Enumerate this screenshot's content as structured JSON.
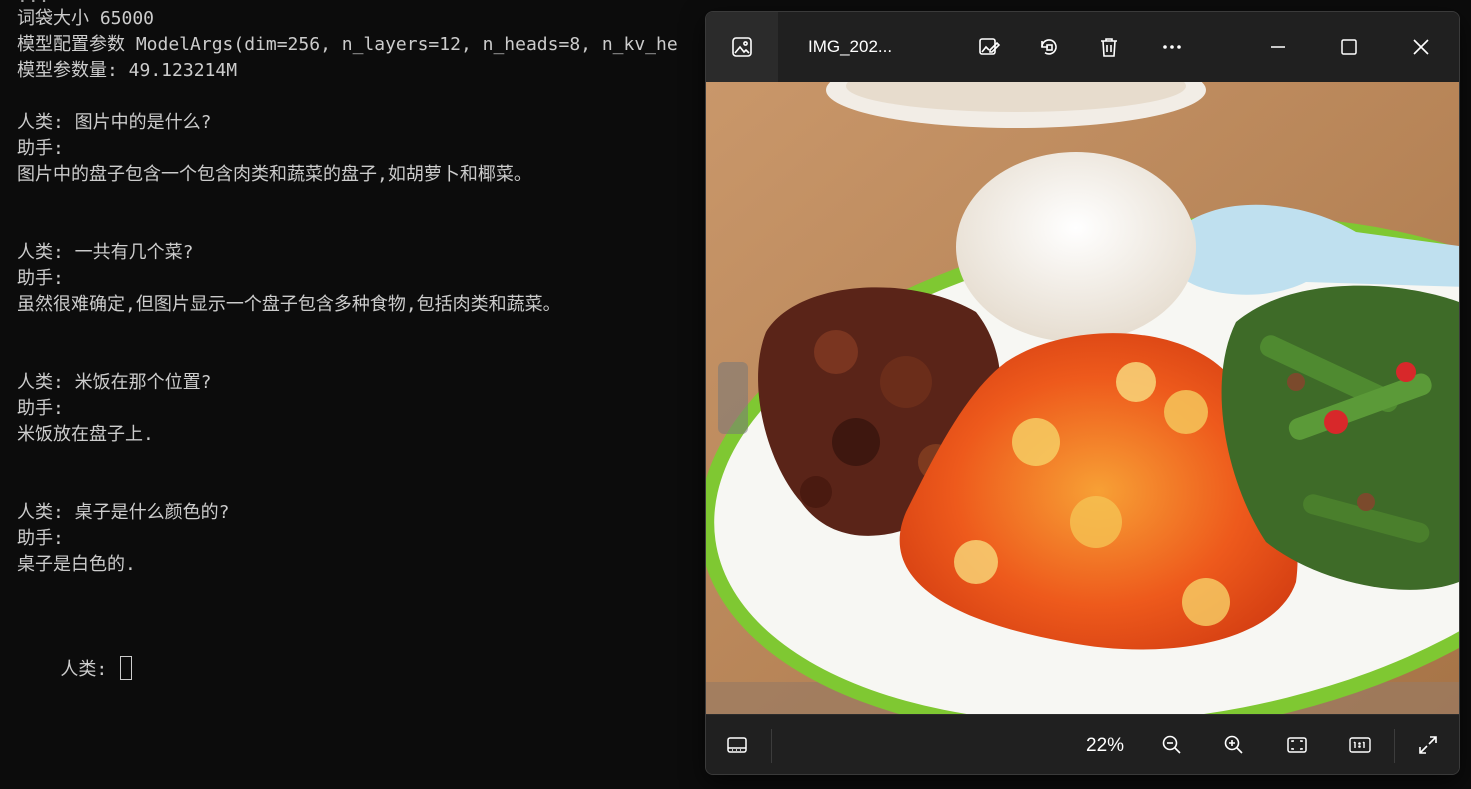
{
  "terminal": {
    "top_cut": "...",
    "lines": [
      "词袋大小 65000",
      "模型配置参数 ModelArgs(dim=256, n_layers=12, n_heads=8, n_kv_he",
      "模型参数量: 49.123214M",
      "",
      "人类: 图片中的是什么?",
      "助手:",
      "图片中的盘子包含一个包含肉类和蔬菜的盘子,如胡萝卜和椰菜。",
      "",
      "",
      "人类: 一共有几个菜?",
      "助手:",
      "虽然很难确定,但图片显示一个盘子包含多种食物,包括肉类和蔬菜。",
      "",
      "",
      "人类: 米饭在那个位置?",
      "助手:",
      "米饭放在盘子上.",
      "",
      "",
      "人类: 桌子是什么颜色的?",
      "助手:",
      "桌子是白色的.",
      "",
      ""
    ],
    "prompt": "人类: "
  },
  "viewer": {
    "title": "IMG_202...",
    "zoom": "22%",
    "icons": {
      "gallery": "gallery-icon",
      "edit": "edit-image-icon",
      "rotate": "rotate-icon",
      "delete": "delete-icon",
      "more": "more-icon",
      "minimize": "minimize-icon",
      "maximize": "maximize-icon",
      "close": "close-icon",
      "filmstrip": "filmstrip-icon",
      "zoom_out": "zoom-out-icon",
      "zoom_in": "zoom-in-icon",
      "fit": "fit-to-window-icon",
      "actual_size": "actual-size-icon",
      "fullscreen": "fullscreen-icon"
    },
    "colors": {
      "background": "#202020",
      "table": "#b98a5e",
      "plate_rim": "#7fc832",
      "rice": "#f3eee6",
      "egg_tomato": "#ef5a1e",
      "green_beans": "#3e6b28",
      "braised_meat": "#5a2418",
      "spoon": "#bfe0ef"
    }
  }
}
